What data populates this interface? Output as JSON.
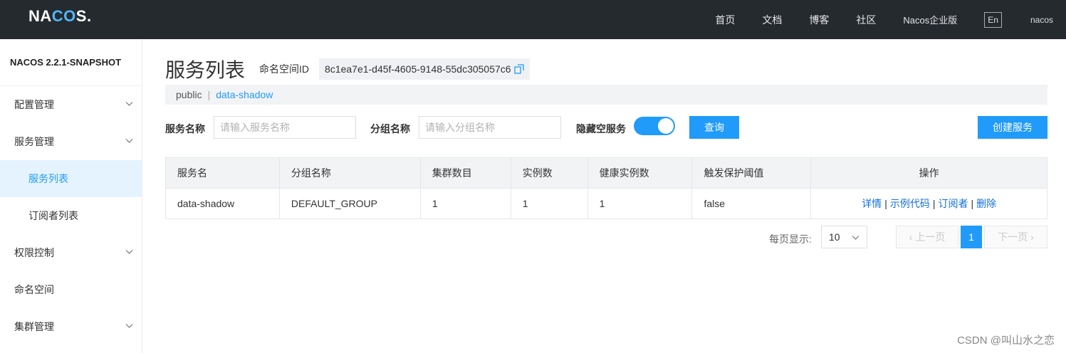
{
  "header": {
    "logo_prefix": "NA",
    "logo_mid": "CO",
    "logo_suffix": "S.",
    "nav": [
      "首页",
      "文档",
      "博客",
      "社区",
      "Nacos企业版"
    ],
    "lang": "En",
    "user": "nacos"
  },
  "sidebar": {
    "version": "NACOS 2.2.1-SNAPSHOT",
    "items": [
      {
        "label": "配置管理"
      },
      {
        "label": "服务管理"
      },
      {
        "label": "服务列表"
      },
      {
        "label": "订阅者列表"
      },
      {
        "label": "权限控制"
      },
      {
        "label": "命名空间"
      },
      {
        "label": "集群管理"
      }
    ]
  },
  "page": {
    "title": "服务列表",
    "ns_label": "命名空间ID",
    "ns_id": "8c1ea7e1-d45f-4605-9148-55dc305057c6",
    "ns_public": "public",
    "ns_sep": "|",
    "ns_current": "data-shadow"
  },
  "filter": {
    "service_label": "服务名称",
    "service_placeholder": "请输入服务名称",
    "group_label": "分组名称",
    "group_placeholder": "请输入分组名称",
    "hide_empty_label": "隐藏空服务",
    "hide_empty_on": true,
    "query_button": "查询",
    "create_button": "创建服务"
  },
  "table": {
    "headers": [
      "服务名",
      "分组名称",
      "集群数目",
      "实例数",
      "健康实例数",
      "触发保护阈值",
      "操作"
    ],
    "rows": [
      {
        "name": "data-shadow",
        "group": "DEFAULT_GROUP",
        "clusters": "1",
        "instances": "1",
        "healthy": "1",
        "threshold": "false"
      }
    ],
    "ops": [
      "详情",
      "示例代码",
      "订阅者",
      "删除"
    ],
    "op_sep": "|"
  },
  "pagination": {
    "per_page_label": "每页显示:",
    "per_page": "10",
    "prev": "上一页",
    "next": "下一页",
    "current_page": "1"
  },
  "watermark": "CSDN @叫山水之恋"
}
